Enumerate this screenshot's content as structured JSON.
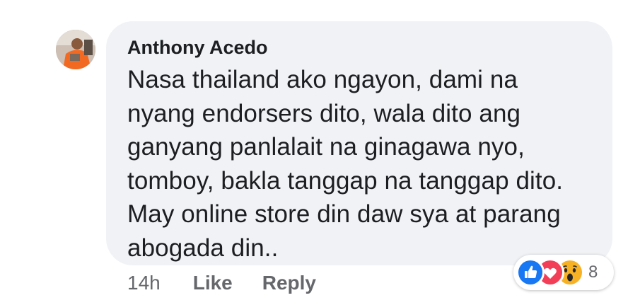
{
  "comment": {
    "author": "Anthony Acedo",
    "text": "Nasa thailand ako ngayon, dami na\nnyang endorsers dito, wala dito ang\nganyang panlalait na ginagawa nyo,\ntomboy, bakla tanggap na tanggap dito.\nMay online store din daw sya at parang\nabogada din..",
    "timestamp": "14h",
    "like_label": "Like",
    "reply_label": "Reply",
    "reactions": {
      "icons": [
        "like-reaction",
        "love-reaction",
        "wow-reaction"
      ],
      "count": "8"
    }
  },
  "colors": {
    "bubble": "#f0f2f5",
    "text": "#1c1e21",
    "secondary": "#65676b",
    "like_blue": "#1877f2",
    "love_red": "#f33e58",
    "wow_yellow": "#f7b125"
  }
}
